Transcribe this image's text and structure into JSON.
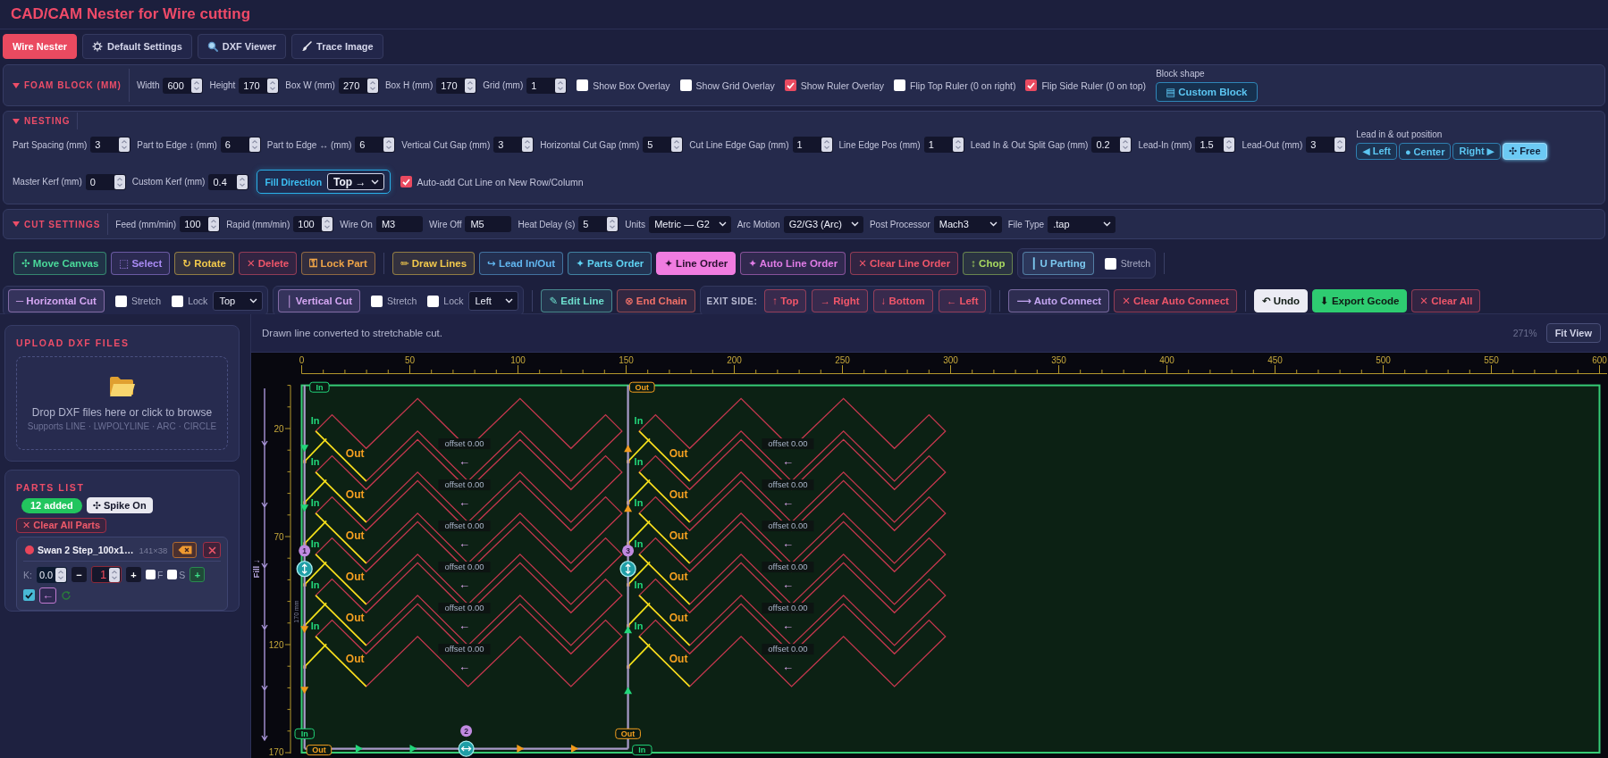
{
  "app": {
    "title": "CAD/CAM Nester for Wire cutting"
  },
  "tabs": [
    {
      "label": "Wire Nester",
      "selected": true
    },
    {
      "label": "Default Settings",
      "selected": false
    },
    {
      "label": "DXF Viewer",
      "selected": false
    },
    {
      "label": "Trace Image",
      "selected": false
    }
  ],
  "panels": [
    {
      "title": "FOAM BLOCK (MM)",
      "expanded": true,
      "rows": [
        [
          {
            "kind": "number",
            "label": "Width",
            "value": "600"
          },
          {
            "kind": "number",
            "label": "Height",
            "value": "170"
          },
          {
            "kind": "number",
            "label": "Box W (mm)",
            "value": "270"
          },
          {
            "kind": "number",
            "label": "Box H (mm)",
            "value": "170"
          },
          {
            "kind": "number",
            "label": "Grid (mm)",
            "value": "1"
          },
          {
            "kind": "checkbox",
            "label": "Show Box Overlay",
            "checked": false
          },
          {
            "kind": "checkbox",
            "label": "Show Grid Overlay",
            "checked": false
          },
          {
            "kind": "checkbox",
            "label": "Show Ruler Overlay",
            "checked": true
          },
          {
            "kind": "checkbox",
            "label": "Flip Top Ruler (0 on right)",
            "checked": false
          },
          {
            "kind": "checkbox",
            "label": "Flip Side Ruler (0 on top)",
            "checked": true
          },
          {
            "kind": "action",
            "label": "Block shape",
            "button": "▤ Custom Block"
          }
        ]
      ]
    },
    {
      "title": "NESTING",
      "expanded": true,
      "rows": [
        [
          {
            "kind": "number",
            "label": "Part Spacing (mm)",
            "value": "3"
          },
          {
            "kind": "number",
            "label": "Part to Edge ↕ (mm)",
            "value": "6"
          },
          {
            "kind": "number",
            "label": "Part to Edge ↔ (mm)",
            "value": "6"
          },
          {
            "kind": "number",
            "label": "Vertical Cut Gap (mm)",
            "value": "3"
          },
          {
            "kind": "number",
            "label": "Horizontal Cut Gap (mm)",
            "value": "5"
          },
          {
            "kind": "number",
            "label": "Cut Line Edge Gap (mm)",
            "value": "1"
          },
          {
            "kind": "number",
            "label": "Line Edge Pos (mm)",
            "value": "1"
          },
          {
            "kind": "number",
            "label": "Lead In & Out Split Gap (mm)",
            "value": "0.2"
          },
          {
            "kind": "number",
            "label": "Lead-In (mm)",
            "value": "1.5"
          },
          {
            "kind": "number",
            "label": "Lead-Out (mm)",
            "value": "3"
          },
          {
            "kind": "segmented",
            "label": "Lead in & out position",
            "options": [
              {
                "label": "◀ Left",
                "selected": false
              },
              {
                "label": "● Center",
                "selected": false
              },
              {
                "label": "Right ▶",
                "selected": false
              },
              {
                "label": "✣ Free",
                "selected": true
              }
            ]
          }
        ],
        [
          {
            "kind": "number",
            "label": "Master Kerf (mm)",
            "value": "0"
          },
          {
            "kind": "number",
            "label": "Custom Kerf (mm)",
            "value": "0.4"
          },
          {
            "kind": "highlight_select",
            "label": "Fill Direction",
            "value": "Top →"
          },
          {
            "kind": "checkbox",
            "label": "Auto-add Cut Line on New Row/Column",
            "checked": true
          }
        ]
      ]
    },
    {
      "title": "CUT SETTINGS",
      "expanded": true,
      "rows": [
        [
          {
            "kind": "number",
            "label": "Feed (mm/min)",
            "value": "100"
          },
          {
            "kind": "number",
            "label": "Rapid (mm/min)",
            "value": "100"
          },
          {
            "kind": "text",
            "label": "Wire On",
            "value": "M3"
          },
          {
            "kind": "text",
            "label": "Wire Off",
            "value": "M5"
          },
          {
            "kind": "number",
            "label": "Heat Delay (s)",
            "value": "5"
          },
          {
            "kind": "select",
            "label": "Units",
            "value": "Metric — G2"
          },
          {
            "kind": "select",
            "label": "Arc Motion",
            "value": "G2/G3 (Arc)"
          },
          {
            "kind": "select",
            "label": "Post Processor",
            "value": "Mach3"
          },
          {
            "kind": "select",
            "label": "File Type",
            "value": ".tap"
          }
        ]
      ]
    }
  ],
  "toolbar": [
    [
      {
        "kind": "button",
        "label": "✣ Move Canvas",
        "color": "#4ad99a",
        "selected": false
      },
      {
        "kind": "button",
        "label": "⬚ Select",
        "color": "#a98bf5",
        "selected": false
      },
      {
        "kind": "button",
        "label": "↻ Rotate",
        "color": "#f2c94c",
        "selected": false
      },
      {
        "kind": "button",
        "label": "✕ Delete",
        "color": "#f0566a",
        "selected": false
      },
      {
        "kind": "button",
        "label": "⚿ Lock Part",
        "color": "#f0a548",
        "selected": false
      },
      {
        "kind": "divider"
      },
      {
        "kind": "button",
        "label": "✏ Draw Lines",
        "color": "#f2c94c",
        "selected": false
      },
      {
        "kind": "button",
        "label": "↪ Lead In/Out",
        "color": "#62b6f0",
        "selected": false
      },
      {
        "kind": "button",
        "label": "✦ Parts Order",
        "color": "#5fd3f3",
        "selected": false
      },
      {
        "kind": "button",
        "label": "✦ Line Order",
        "color": "#f07ce0",
        "selected": true
      },
      {
        "kind": "button",
        "label": "✦ Auto Line Order",
        "color": "#e07ce6",
        "selected": false
      },
      {
        "kind": "button",
        "label": "✕ Clear Line Order",
        "color": "#f0566a",
        "selected": false
      },
      {
        "kind": "button",
        "label": "↕ Chop",
        "color": "#a8d860",
        "selected": false
      },
      {
        "kind": "group",
        "items": [
          {
            "kind": "button",
            "label": "┃ U Parting",
            "color": "#7cc8f0",
            "selected": false
          },
          {
            "kind": "checkbox",
            "label": "Stretch",
            "checked": false
          }
        ]
      },
      {
        "kind": "divider"
      }
    ],
    [
      {
        "kind": "group",
        "items": [
          {
            "kind": "button",
            "label": "─ Horizontal Cut",
            "color": "#d4a6f2",
            "selected": false
          },
          {
            "kind": "checkbox",
            "label": "Stretch",
            "checked": false
          },
          {
            "kind": "checkbox",
            "label": "Lock",
            "checked": false
          },
          {
            "kind": "select",
            "value": "Top"
          }
        ]
      },
      {
        "kind": "group",
        "items": [
          {
            "kind": "button",
            "label": "│ Vertical Cut",
            "color": "#d4a6f2",
            "selected": false
          },
          {
            "kind": "checkbox",
            "label": "Stretch",
            "checked": false
          },
          {
            "kind": "checkbox",
            "label": "Lock",
            "checked": false
          },
          {
            "kind": "select",
            "value": "Left"
          }
        ]
      },
      {
        "kind": "divider"
      },
      {
        "kind": "button",
        "label": "✎ Edit Line",
        "color": "#6ee0cf",
        "selected": false
      },
      {
        "kind": "button",
        "label": "⊗ End Chain",
        "color": "#f07068",
        "selected": false
      },
      {
        "kind": "group",
        "items": [
          {
            "kind": "label",
            "label": "EXIT SIDE:"
          },
          {
            "kind": "button",
            "label": "↑ Top",
            "color": "#f0566a",
            "selected": false
          },
          {
            "kind": "button",
            "label": "→ Right",
            "color": "#f0566a",
            "selected": false
          },
          {
            "kind": "button",
            "label": "↓ Bottom",
            "color": "#f0566a",
            "selected": false
          },
          {
            "kind": "button",
            "label": "← Left",
            "color": "#f0566a",
            "selected": false
          }
        ]
      },
      {
        "kind": "divider"
      },
      {
        "kind": "button",
        "label": "⟶ Auto Connect",
        "color": "#c4a6f2",
        "selected": false
      },
      {
        "kind": "button",
        "label": "✕ Clear Auto Connect",
        "color": "#f0566a",
        "selected": false
      },
      {
        "kind": "divider"
      },
      {
        "kind": "solid_button",
        "label": "↶ Undo",
        "color": "#ececf4"
      },
      {
        "kind": "solid_button",
        "label": "⬇ Export Gcode",
        "color": "#2ecc71"
      },
      {
        "kind": "button",
        "label": "✕ Clear All",
        "color": "#f0566a",
        "selected": false
      }
    ]
  ],
  "upload": {
    "title": "UPLOAD DXF FILES",
    "prompt": "Drop DXF files here or click to browse",
    "hint": "Supports LINE · LWPOLYLINE · ARC · CIRCLE"
  },
  "parts_list": {
    "title": "PARTS LIST",
    "count": "12 added",
    "spike": {
      "label": "✣ Spike On",
      "on": true
    },
    "clear_button": "✕ Clear All Parts",
    "parts": [
      {
        "name": "Swan 2 Step_100x1…",
        "size": "141×38",
        "color": "#e8455a",
        "k_label": "K:",
        "k_value": "0.0",
        "minus": "−",
        "qty": "1",
        "plus": "+",
        "flags": [
          {
            "label": "F",
            "checked": false
          },
          {
            "label": "S",
            "checked": false
          }
        ],
        "add": "+",
        "checked": true,
        "back": "←"
      }
    ]
  },
  "status_bar": {
    "message": "Drawn line converted to stretchable cut.",
    "zoom": "271%",
    "fit_button": "Fit View"
  },
  "canvas": {
    "top_ruler": [
      "0",
      "50",
      "100",
      "150",
      "200",
      "250",
      "300",
      "350",
      "400",
      "450",
      "500",
      "550",
      "600"
    ],
    "side_ruler": [
      "20",
      "70",
      "120",
      "170"
    ],
    "fill_label": "Fill ↓",
    "height_label": "170 mm",
    "cut_lines": [
      {
        "number": "1"
      },
      {
        "number": "2"
      },
      {
        "number": "3"
      }
    ],
    "tags": [
      {
        "text": "In",
        "color": "#22d67a"
      },
      {
        "text": "Out",
        "color": "#f5a020"
      },
      {
        "text": "In",
        "color": "#22d67a"
      },
      {
        "text": "Out",
        "color": "#f5a020"
      },
      {
        "text": "Out",
        "color": "#f5a020"
      },
      {
        "text": "In",
        "color": "#22d67a"
      }
    ],
    "parts": [
      {
        "lead_in": "In",
        "lead_out": "Out",
        "offset": "offset 0.00",
        "direction": "←"
      },
      {
        "lead_in": "In",
        "lead_out": "Out",
        "offset": "offset 0.00",
        "direction": "←"
      },
      {
        "lead_in": "In",
        "lead_out": "Out",
        "offset": "offset 0.00",
        "direction": "←"
      },
      {
        "lead_in": "In",
        "lead_out": "Out",
        "offset": "offset 0.00",
        "direction": "←"
      },
      {
        "lead_in": "In",
        "lead_out": "Out",
        "offset": "offset 0.00",
        "direction": "←"
      },
      {
        "lead_in": "In",
        "lead_out": "Out",
        "offset": "offset 0.00",
        "direction": "←"
      },
      {
        "lead_in": "In",
        "lead_out": "Out",
        "offset": "offset 0.00",
        "direction": "←"
      },
      {
        "lead_in": "In",
        "lead_out": "Out",
        "offset": "offset 0.00",
        "direction": "←"
      },
      {
        "lead_in": "In",
        "lead_out": "Out",
        "offset": "offset 0.00",
        "direction": "←"
      },
      {
        "lead_in": "In",
        "lead_out": "Out",
        "offset": "offset 0.00",
        "direction": "←"
      },
      {
        "lead_in": "In",
        "lead_out": "Out",
        "offset": "offset 0.00",
        "direction": "←"
      },
      {
        "lead_in": "In",
        "lead_out": "Out",
        "offset": "offset 0.00",
        "direction": "←"
      }
    ]
  }
}
